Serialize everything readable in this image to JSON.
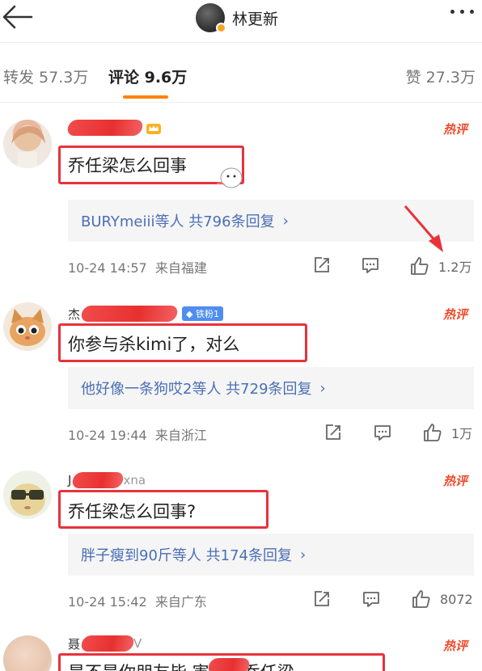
{
  "header": {
    "back_icon": "arrow-left-icon",
    "author_name": "林更新",
    "more_icon": "more-dots-icon"
  },
  "tabs": {
    "repost": "转发 57.3万",
    "comment": "评论 9.6万",
    "like": "赞 27.3万"
  },
  "accent_color": "#ff8200",
  "link_color": "#4a6fb5",
  "highlight_color": "#e8323c",
  "comments": [
    {
      "hot_label": "热评",
      "text": "乔任梁怎么回事",
      "replies": "BURYmeiii等人  共796条回复",
      "time": "10-24 14:57",
      "location": "来自福建",
      "likes": "1.2万"
    },
    {
      "name_prefix": "杰",
      "badge": "铁粉1",
      "hot_label": "热评",
      "text": "你参与杀kimi了，对么",
      "replies": "他好像一条狗哎2等人  共729条回复",
      "time": "10-24 19:44",
      "location": "来自浙江",
      "likes": "1万"
    },
    {
      "name_prefix": "J",
      "name_suffix": "xna",
      "hot_label": "热评",
      "text": "乔任梁怎么回事?",
      "replies": "胖子瘦到90斤等人  共174条回复",
      "time": "10-24 15:42",
      "location": "来自广东",
      "likes": "8072"
    },
    {
      "name_prefix": "聂",
      "name_suffix": "V",
      "hot_label": "热评",
      "text": "是不是你朋友毕 害死了乔任梁"
    }
  ]
}
